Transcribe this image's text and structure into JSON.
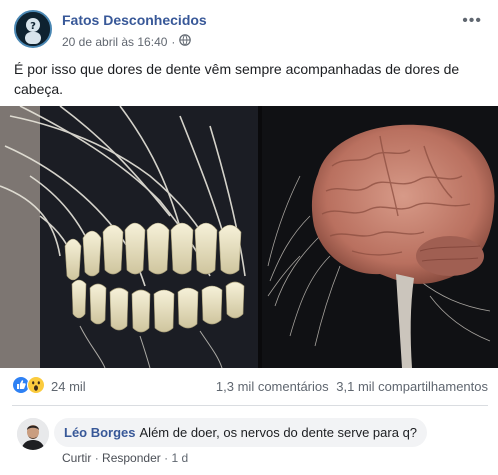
{
  "post": {
    "page_name": "Fatos Desconhecidos",
    "date": "20 de abril às 16:40",
    "dot": "·",
    "audience_icon": "globe-icon",
    "more_icon": "more-options-icon",
    "more_glyph": "•••",
    "text": "É por isso que dores de dente vêm sempre acompanhadas de dores de cabeça."
  },
  "media": {
    "left_subject": "teeth-nerves-image",
    "right_subject": "brain-nerves-image"
  },
  "stats": {
    "reaction_icons": [
      "like-icon",
      "wow-icon"
    ],
    "reaction_count": "24 mil",
    "comments": "1,3 mil comentários",
    "shares": "3,1 mil compartilhamentos"
  },
  "comment": {
    "author": "Léo Borges",
    "text": "Além de doer, os nervos do dente serve para q?",
    "like_label": "Curtir",
    "sep": "·",
    "reply_label": "Responder",
    "age": "1 d"
  },
  "colors": {
    "link": "#385898",
    "like_blue": "#2e81f4",
    "wow_yellow": "#fbcb3d"
  }
}
